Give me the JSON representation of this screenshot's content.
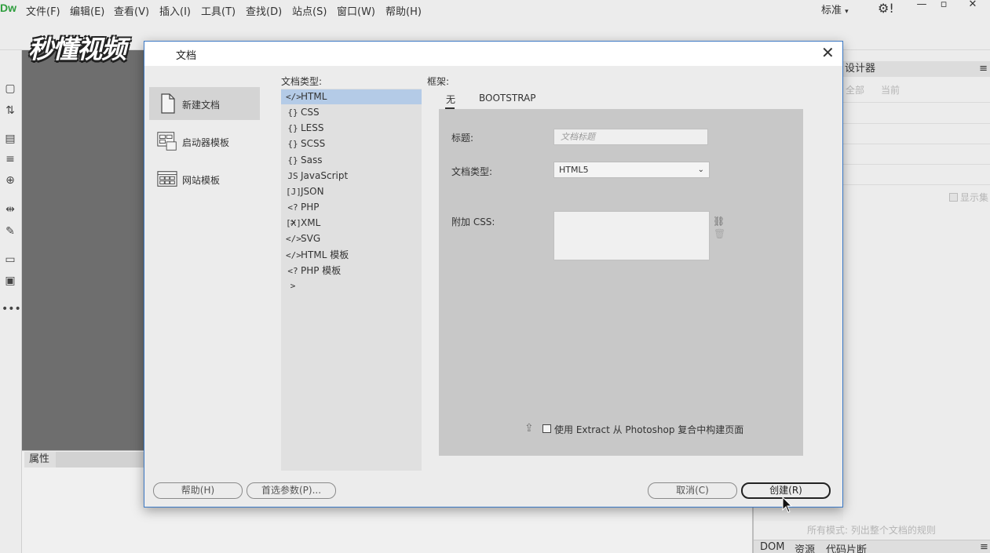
{
  "app": {
    "logo": "Dw"
  },
  "menu": [
    "文件(F)",
    "编辑(E)",
    "查看(V)",
    "插入(I)",
    "工具(T)",
    "查找(D)",
    "站点(S)",
    "窗口(W)",
    "帮助(H)"
  ],
  "workspace_switcher": "标准",
  "watermark": "秒懂视频",
  "dialog": {
    "title": "文档",
    "categories": [
      "新建文档",
      "启动器模板",
      "网站模板"
    ],
    "doc_type_label": "文档类型:",
    "doc_types": [
      {
        "label": "HTML",
        "icon": "</>"
      },
      {
        "label": "CSS",
        "icon": "{}"
      },
      {
        "label": "LESS",
        "icon": "{}"
      },
      {
        "label": "SCSS",
        "icon": "{}"
      },
      {
        "label": "Sass",
        "icon": "{}"
      },
      {
        "label": "JavaScript",
        "icon": "JS"
      },
      {
        "label": "JSON",
        "icon": "[J]"
      },
      {
        "label": "PHP",
        "icon": "<?>"
      },
      {
        "label": "XML",
        "icon": "[X]"
      },
      {
        "label": "SVG",
        "icon": "</>"
      },
      {
        "label": "HTML 模板",
        "icon": "</>"
      },
      {
        "label": "PHP 模板",
        "icon": "<?>"
      }
    ],
    "framework_label": "框架:",
    "framework_tabs": [
      "无",
      "BOOTSTRAP"
    ],
    "title_label": "标题:",
    "title_placeholder": "文档标题",
    "doctype_label": "文档类型:",
    "doctype_value": "HTML5",
    "css_label": "附加 CSS:",
    "extract_label": "使用 Extract 从 Photoshop 复合中构建页面",
    "buttons": {
      "help": "帮助(H)",
      "prefs": "首选参数(P)...",
      "cancel": "取消(C)",
      "create": "创建(R)"
    }
  },
  "properties_tab": "属性",
  "right_panel": {
    "title": "设计器",
    "all": "全部",
    "current": "当前",
    "show_label": "显示集",
    "status": "所有模式: 列出整个文档的规则",
    "bottom_tabs": [
      "DOM",
      "资源",
      "代码片断"
    ]
  }
}
